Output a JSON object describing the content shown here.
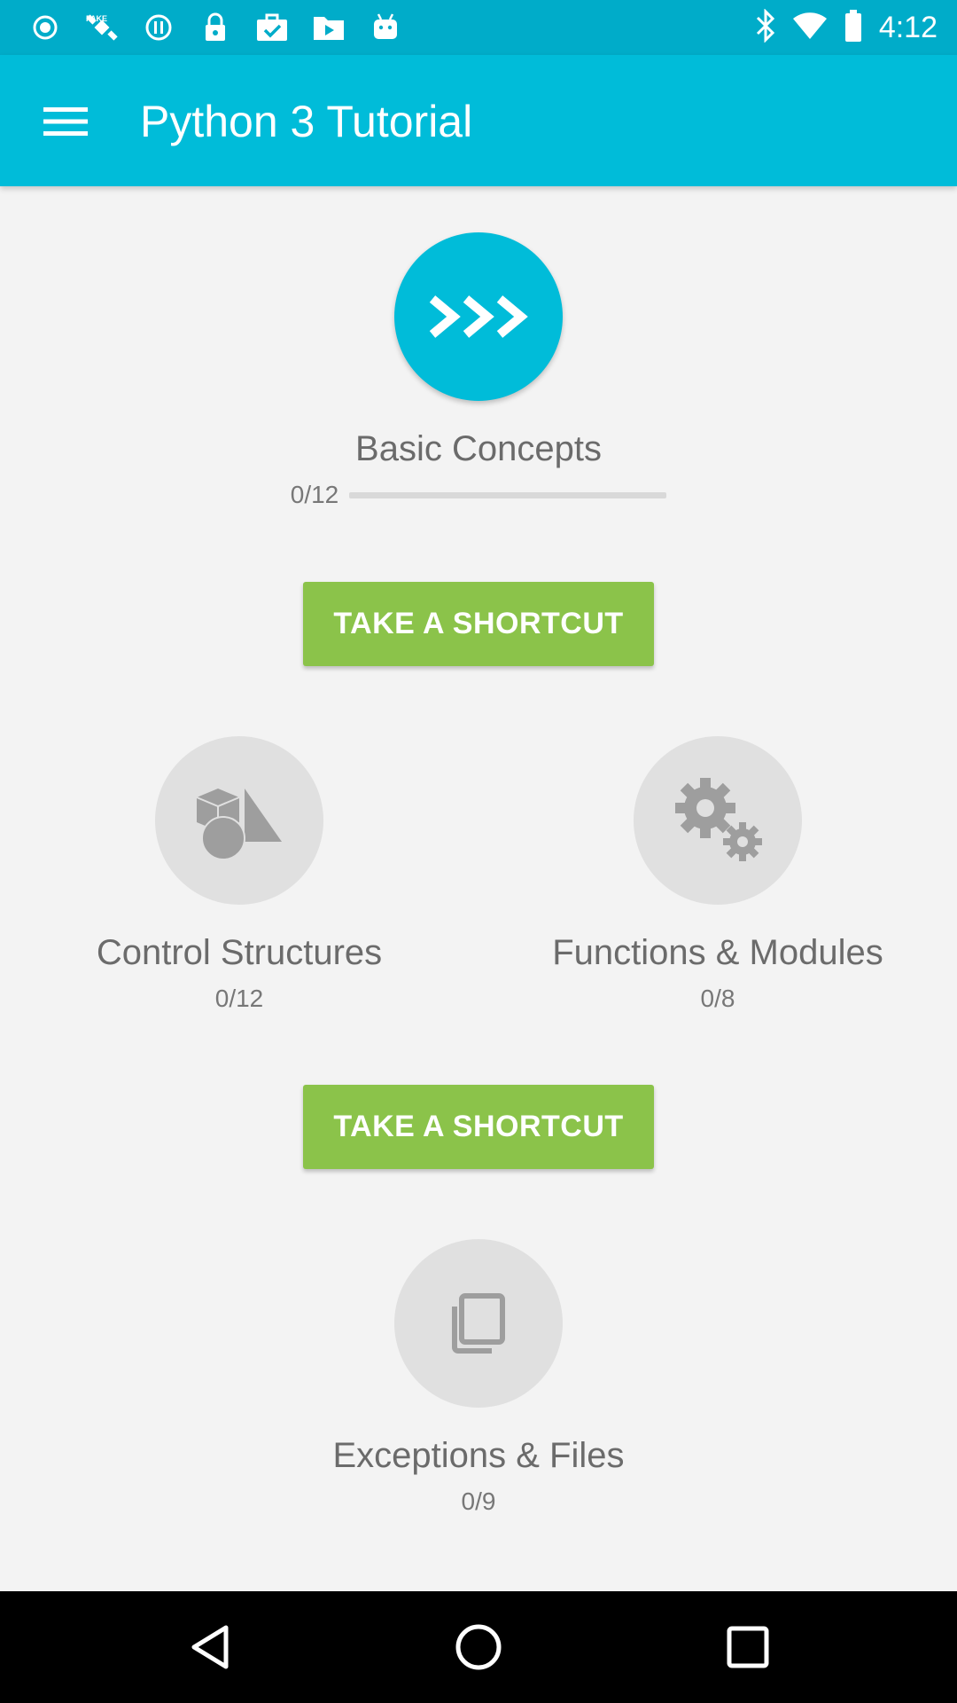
{
  "status_bar": {
    "time": "4:12",
    "icons": [
      "record-icon",
      "satellite-icon",
      "pause-circle-icon",
      "lock-icon",
      "briefcase-check-icon",
      "play-folder-icon",
      "android-icon",
      "bluetooth-icon",
      "wifi-icon",
      "battery-icon"
    ]
  },
  "app_bar": {
    "menu_icon": "menu-icon",
    "title": "Python 3 Tutorial"
  },
  "lessons": [
    {
      "id": "basic-concepts",
      "title": "Basic Concepts",
      "progress": "0/12",
      "progress_fraction": 0,
      "icon": "prompt-chevrons-icon",
      "active": true
    },
    {
      "id": "control-structures",
      "title": "Control Structures",
      "progress": "0/12",
      "icon": "shapes-icon",
      "active": false
    },
    {
      "id": "functions-modules",
      "title": "Functions & Modules",
      "progress": "0/8",
      "icon": "gears-icon",
      "active": false
    },
    {
      "id": "exceptions-files",
      "title": "Exceptions & Files",
      "progress": "0/9",
      "icon": "files-icon",
      "active": false
    }
  ],
  "shortcuts": [
    {
      "label": "TAKE A SHORTCUT"
    },
    {
      "label": "TAKE A SHORTCUT"
    }
  ],
  "colors": {
    "primary": "#00bcd9",
    "primary_dark": "#00acc9",
    "accent_green": "#8bc34a",
    "background": "#f3f3f3",
    "locked_circle": "#e0e0e0",
    "locked_icon": "#9e9e9e"
  },
  "nav_bar": {
    "icons": [
      "back-icon",
      "home-icon",
      "recents-icon"
    ]
  }
}
